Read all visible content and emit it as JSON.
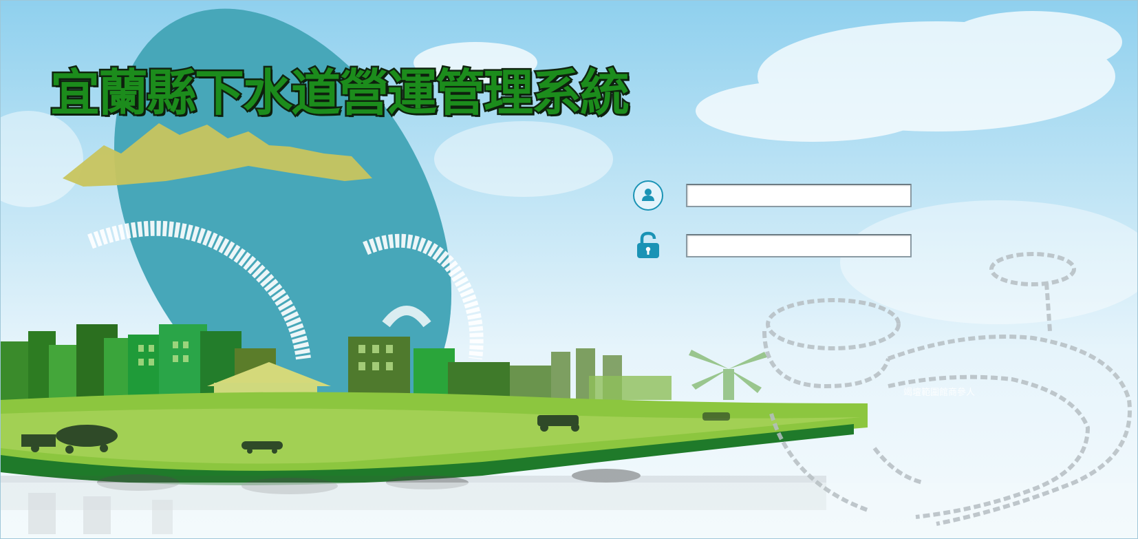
{
  "app": {
    "title": "宜蘭縣下水道營運管理系統"
  },
  "login": {
    "username": {
      "value": "",
      "placeholder": "",
      "icon": "user-icon"
    },
    "password": {
      "value": "",
      "placeholder": "",
      "icon": "lock-icon"
    }
  },
  "background": {
    "credit_text": "竭壇範圍館商參人"
  },
  "colors": {
    "title_fill": "#1c8c1c",
    "title_outline": "#102410",
    "icon_accent": "#1a93b5",
    "sky": "#8fd0ee"
  }
}
